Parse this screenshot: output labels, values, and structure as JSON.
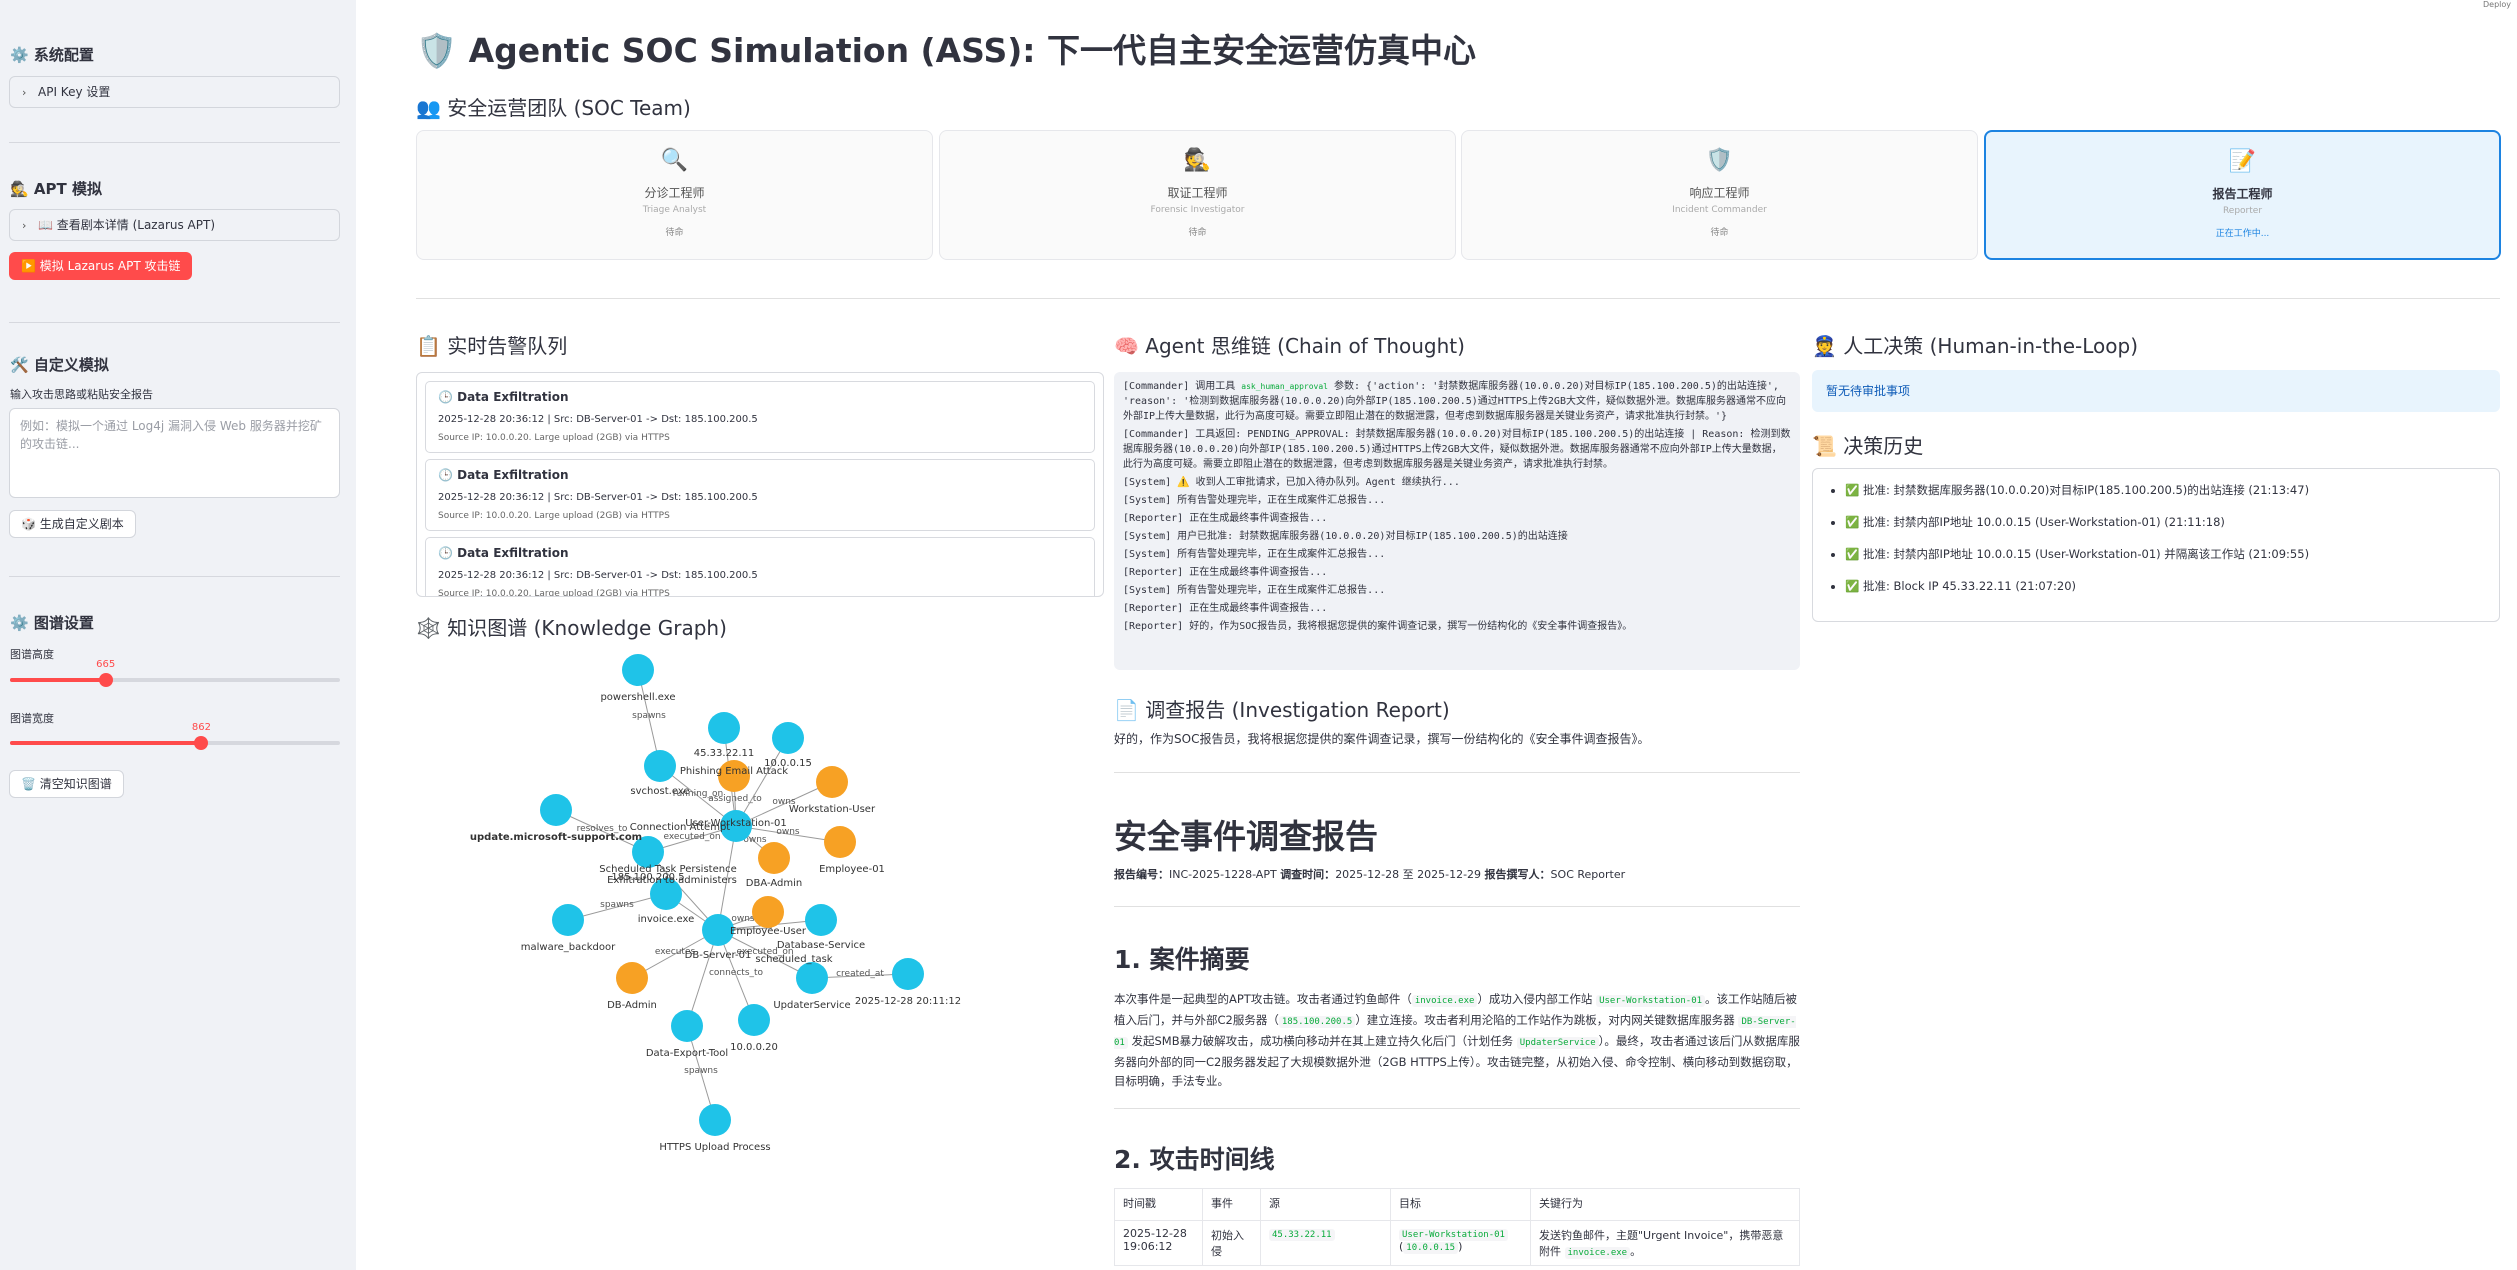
{
  "sidebar": {
    "system_config": "⚙️ 系统配置",
    "api_key_expander": "API Key 设置",
    "apt_sim": "🕵️ APT 模拟",
    "script_expander": "📖 查看剧本详情 (Lazarus APT)",
    "simulate_button": "▶️ 模拟 Lazarus APT 攻击链",
    "custom_sim": "🛠️ 自定义模拟",
    "custom_label": "输入攻击思路或粘贴安全报告",
    "custom_placeholder": "例如：模拟一个通过 Log4j 漏洞入侵 Web 服务器并挖矿的攻击链...",
    "generate_button": "🎲 生成自定义剧本",
    "graph_settings": "⚙️ 图谱设置",
    "graph_height_label": "图谱高度",
    "graph_height_value": 665,
    "graph_height_fraction": 0.29,
    "graph_width_label": "图谱宽度",
    "graph_width_value": 862,
    "graph_width_fraction": 0.58,
    "clear_graph_button": "🗑️ 清空知识图谱"
  },
  "header": {
    "title": "🛡️ Agentic SOC Simulation (ASS): 下一代自主安全运营仿真中心",
    "team_title": "👥 安全运营团队 (SOC Team)",
    "deploy": "Deploy"
  },
  "team": [
    {
      "icon": "🔍",
      "name": "分诊工程师",
      "en": "Triage Analyst",
      "status": "待命",
      "active": false
    },
    {
      "icon": "🕵️",
      "name": "取证工程师",
      "en": "Forensic Investigator",
      "status": "待命",
      "active": false
    },
    {
      "icon": "🛡️",
      "name": "响应工程师",
      "en": "Incident Commander",
      "status": "待命",
      "active": false
    },
    {
      "icon": "📝",
      "name": "报告工程师",
      "en": "Reporter",
      "status": "正在工作中...",
      "active": true
    }
  ],
  "alerts": {
    "title": "📋 实时告警队列",
    "items": [
      {
        "title": "🕒 Data Exfiltration",
        "meta": "2025-12-28 20:36:12 | Src: DB-Server-01 -> Dst: 185.100.200.5",
        "source": "Source IP: 10.0.0.20. Large upload (2GB) via HTTPS"
      },
      {
        "title": "🕒 Data Exfiltration",
        "meta": "2025-12-28 20:36:12 | Src: DB-Server-01 -> Dst: 185.100.200.5",
        "source": "Source IP: 10.0.0.20. Large upload (2GB) via HTTPS"
      },
      {
        "title": "🕒 Data Exfiltration",
        "meta": "2025-12-28 20:36:12 | Src: DB-Server-01 -> Dst: 185.100.200.5",
        "source": "Source IP: 10.0.0.20. Large upload (2GB) via HTTPS"
      }
    ]
  },
  "graph": {
    "title": "🕸️ 知识图谱 (Knowledge Graph)",
    "colors": {
      "entity": "#1fc3e8",
      "actor": "#f7a124",
      "edge": "#9a9a9a"
    },
    "node_labels": [
      "powershell.exe",
      "45.33.22.11",
      "10.0.0.15",
      "svchost.exe",
      "Phishing Email Attack",
      "Workstation-User",
      "update.microsoft-support.com",
      "Connection Attempt",
      "User-Workstation-01",
      "Employee-01",
      "185.100.200.5",
      "Scheduled Task Persistence",
      "Exfiltration to administers",
      "DBA-Admin",
      "invoice.exe",
      "Employee-User",
      "Database-Service",
      "malware_backdoor",
      "DB-Server-01",
      "scheduled_task",
      "DB-Admin",
      "UpdaterService",
      "2025-12-28 20:11:12",
      "Data-Export-Tool",
      "10.0.0.20",
      "HTTPS Upload Process"
    ],
    "edge_labels": [
      "spawns",
      "running_on",
      "assigned_to",
      "owns",
      "owns",
      "resolves_to",
      "executed_on",
      "owns",
      "spawns",
      "owns",
      "executes",
      "executed_on",
      "connects_to",
      "created_at",
      "spawns"
    ]
  },
  "cot": {
    "title": "🧠 Agent 思维链 (Chain of Thought)",
    "line1_prefix": "[Commander] 调用工具",
    "line1_tool": "ask_human_approval",
    "line1_rest": "参数: {'action': '封禁数据库服务器(10.0.0.20)对目标IP(185.100.200.5)的出站连接', 'reason': '检测到数据库服务器(10.0.0.20)向外部IP(185.100.200.5)通过HTTPS上传2GB大文件，疑似数据外泄。数据库服务器通常不应向外部IP上传大量数据，此行为高度可疑。需要立即阻止潜在的数据泄露，但考虑到数据库服务器是关键业务资产，请求批准执行封禁。'}",
    "lines": [
      "[Commander] 工具返回: PENDING_APPROVAL: 封禁数据库服务器(10.0.0.20)对目标IP(185.100.200.5)的出站连接 | Reason: 检测到数据库服务器(10.0.0.20)向外部IP(185.100.200.5)通过HTTPS上传2GB大文件，疑似数据外泄。数据库服务器通常不应向外部IP上传大量数据，此行为高度可疑。需要立即阻止潜在的数据泄露，但考虑到数据库服务器是关键业务资产，请求批准执行封禁。",
      "[System] ⚠️ 收到人工审批请求，已加入待办队列。Agent 继续执行...",
      "[System] 所有告警处理完毕，正在生成案件汇总报告...",
      "[Reporter] 正在生成最终事件调查报告...",
      "[System] 用户已批准: 封禁数据库服务器(10.0.0.20)对目标IP(185.100.200.5)的出站连接",
      "[System] 所有告警处理完毕，正在生成案件汇总报告...",
      "[Reporter] 正在生成最终事件调查报告...",
      "[System] 所有告警处理完毕，正在生成案件汇总报告...",
      "[Reporter] 正在生成最终事件调查报告...",
      "[Reporter] 好的，作为SOC报告员，我将根据您提供的案件调查记录，撰写一份结构化的《安全事件调查报告》。"
    ]
  },
  "report": {
    "title": "📄 调查报告 (Investigation Report)",
    "intro": "好的，作为SOC报告员，我将根据您提供的案件调查记录，撰写一份结构化的《安全事件调查报告》。",
    "h1": "安全事件调查报告",
    "meta_no_label": "报告编号：",
    "meta_no": "INC-2025-1228-APT",
    "meta_time_label": "调查时间：",
    "meta_time": "2025-12-28 至 2025-12-29",
    "meta_author_label": "报告撰写人：",
    "meta_author": "SOC Reporter",
    "section1": "1. 案件摘要",
    "summary_1": "本次事件是一起典型的APT攻击链。攻击者通过钓鱼邮件（",
    "summary_code1": "invoice.exe",
    "summary_2": "）成功入侵内部工作站",
    "summary_code2": "User-Workstation-01",
    "summary_3": "。该工作站随后被植入后门，并与外部C2服务器（",
    "summary_code3": "185.100.200.5",
    "summary_4": "）建立连接。攻击者利用沦陷的工作站作为跳板，对内网关键数据库服务器",
    "summary_code4": "DB-Server-01",
    "summary_5": "发起SMB暴力破解攻击，成功横向移动并在其上建立持久化后门（计划任务",
    "summary_code5": "UpdaterService",
    "summary_6": "）。最终，攻击者通过该后门从数据库服务器向外部的同一C2服务器发起了大规模数据外泄（2GB HTTPS上传）。攻击链完整，从初始入侵、命令控制、横向移动到数据窃取，目标明确，手法专业。",
    "section2": "2. 攻击时间线",
    "table_headers": [
      "时间戳",
      "事件",
      "源",
      "目标",
      "关键行为"
    ],
    "table_row": {
      "time": "2025-12-28 19:06:12",
      "event": "初始入侵",
      "source": "45.33.22.11",
      "target": "User-Workstation-01",
      "target_ip": "10.0.0.15",
      "action_1": "发送钓鱼邮件，主题\"Urgent Invoice\"，携带恶意附件",
      "action_code": "invoice.exe",
      "action_2": "。"
    }
  },
  "hitl": {
    "title": "👮 人工决策 (Human-in-the-Loop)",
    "empty": "暂无待审批事项",
    "history_title": "📜 决策历史",
    "history": [
      "✅ 批准: 封禁数据库服务器(10.0.0.20)对目标IP(185.100.200.5)的出站连接 (21:13:47)",
      "✅ 批准: 封禁内部IP地址 10.0.0.15 (User-Workstation-01) (21:11:18)",
      "✅ 批准: 封禁内部IP地址 10.0.0.15 (User-Workstation-01) 并隔离该工作站 (21:09:55)",
      "✅ 批准: Block IP 45.33.22.11 (21:07:20)"
    ]
  }
}
